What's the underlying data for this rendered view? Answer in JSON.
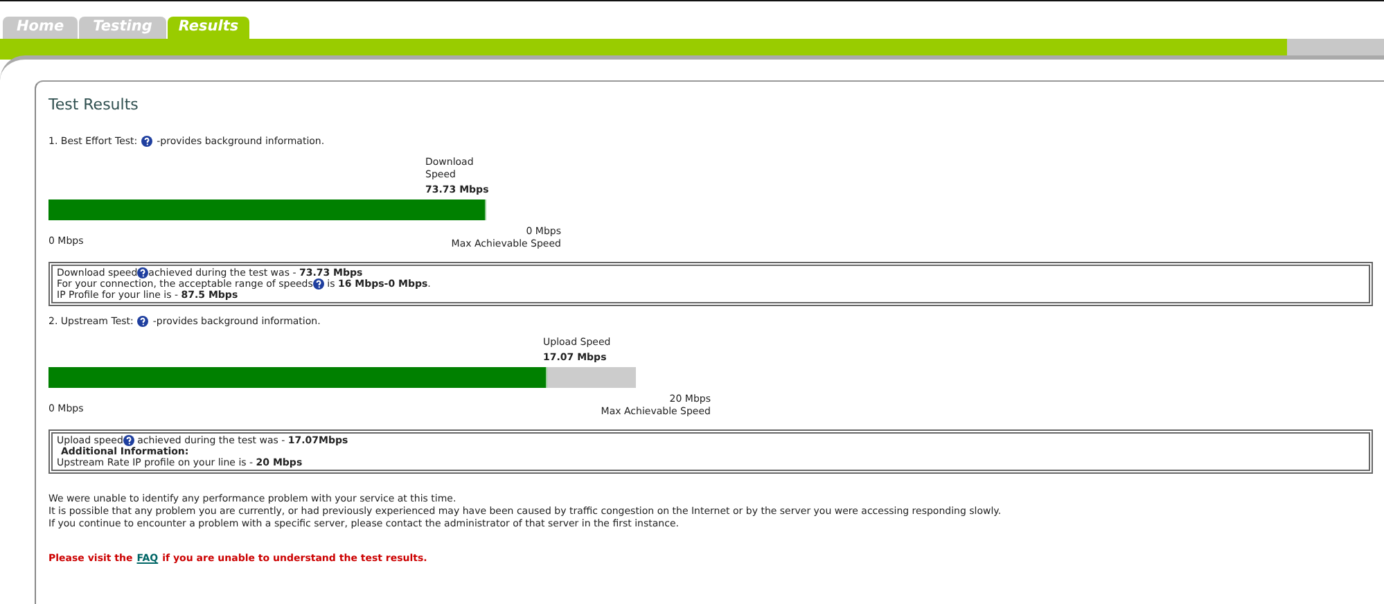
{
  "tabs": [
    {
      "label": "Home",
      "selected": false
    },
    {
      "label": "Testing",
      "selected": false
    },
    {
      "label": "Results",
      "selected": true
    }
  ],
  "title": "Test Results",
  "tests": [
    {
      "heading": "1. Best Effort Test:",
      "note": "-provides background information.",
      "speed_label_lines": [
        "Download",
        "Speed"
      ],
      "speed_value": "73.73 Mbps",
      "level": 1.0,
      "min": "0 Mbps",
      "max": "0 Mbps",
      "max_caption": "Max Achievable Speed",
      "info": [
        {
          "kind": "help",
          "before": "Download speed",
          "after": "achieved during the test was - **73.73 Mbps**"
        },
        {
          "kind": "help",
          "before": "For your connection, the acceptable range of speeds",
          "after": " is **16 Mbps-0 Mbps**."
        },
        {
          "kind": "text",
          "text": "IP Profile for your line is - **87.5 Mbps**"
        }
      ]
    },
    {
      "heading": "2. Upstream Test:",
      "note": "-provides background information.",
      "speed_label_lines": [
        "Upload Speed"
      ],
      "speed_value": "17.07 Mbps",
      "level": 0.85,
      "min": "0 Mbps",
      "max": "20 Mbps",
      "max_caption": "Max Achievable Speed",
      "info": [
        {
          "kind": "help",
          "before": "Upload speed",
          "after": " achieved during the test was - **17.07Mbps**"
        },
        {
          "kind": "heading",
          "text": "Additional Information:"
        },
        {
          "kind": "text",
          "text": "Upstream Rate IP profile on your line is - **20 Mbps**"
        }
      ]
    }
  ],
  "summary": [
    "We were unable to identify any performance problem with your service at this time.",
    "It is possible that any problem you are currently, or had previously experienced may have been caused by traffic congestion on the Internet or by the server you were accessing responding slowly.",
    "If you continue to encounter a problem with a specific server, please contact the administrator of that server in the first instance."
  ],
  "faq": {
    "before": "Please visit the",
    "link": "FAQ",
    "after": "if you are unable to understand the test results."
  }
}
